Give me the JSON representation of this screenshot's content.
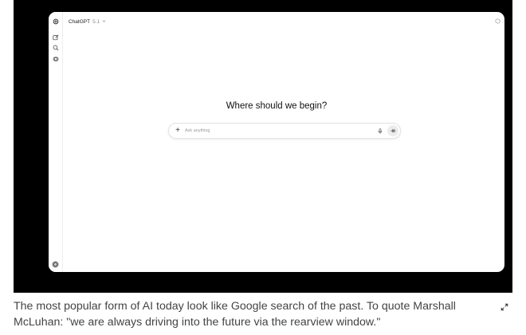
{
  "app": {
    "model_name": "ChatGPT",
    "model_version": "5.1",
    "headline": "Where should we begin?",
    "composer": {
      "placeholder": "Ask anything",
      "value": ""
    },
    "icons": {
      "logo": "openai-logo-icon",
      "new_chat": "new-chat-icon",
      "search": "search-icon",
      "library": "library-icon",
      "temporary_chat": "temporary-chat-icon",
      "add": "plus-icon",
      "mic": "microphone-icon",
      "voice": "voice-mode-icon",
      "model_dropdown": "chevron-down-icon"
    }
  },
  "caption": {
    "text": "The most popular form of AI today look like Google search of the past. To quote Marshall McLuhan: \"we are always driving into the future via the rearview window.\""
  },
  "colors": {
    "frame": "#000000",
    "caption_text": "#444444",
    "headline_text": "#111111"
  }
}
